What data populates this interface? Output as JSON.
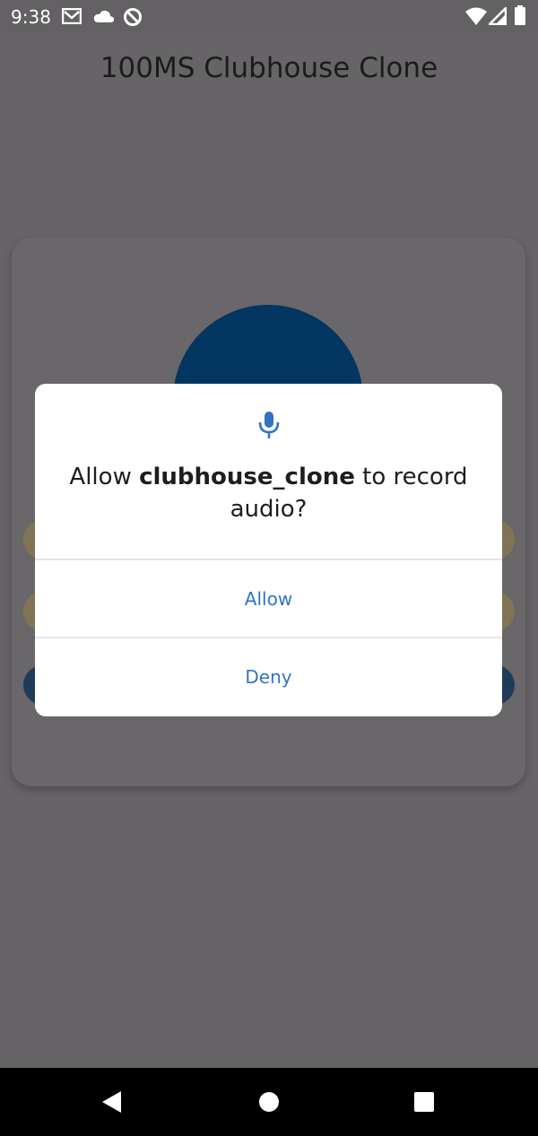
{
  "status_bar": {
    "time": "9:38",
    "icons": [
      "gmail-icon",
      "cloud-icon",
      "sync-icon",
      "wifi-icon",
      "signal-icon",
      "battery-icon"
    ]
  },
  "app": {
    "title": "100MS Clubhouse Clone"
  },
  "dialog": {
    "icon": "microphone-icon",
    "message_prefix": "Allow ",
    "app_name": "clubhouse_clone",
    "message_suffix": " to record audio?",
    "allow_label": "Allow",
    "deny_label": "Deny"
  },
  "nav_bar": {
    "icons": [
      "back-icon",
      "home-icon",
      "recents-icon"
    ]
  },
  "colors": {
    "scrim": "#666466",
    "accent": "#3273c6",
    "avatar": "#033660",
    "pill_yellow": "#7f7555",
    "pill_blue": "#1f3b5a"
  }
}
